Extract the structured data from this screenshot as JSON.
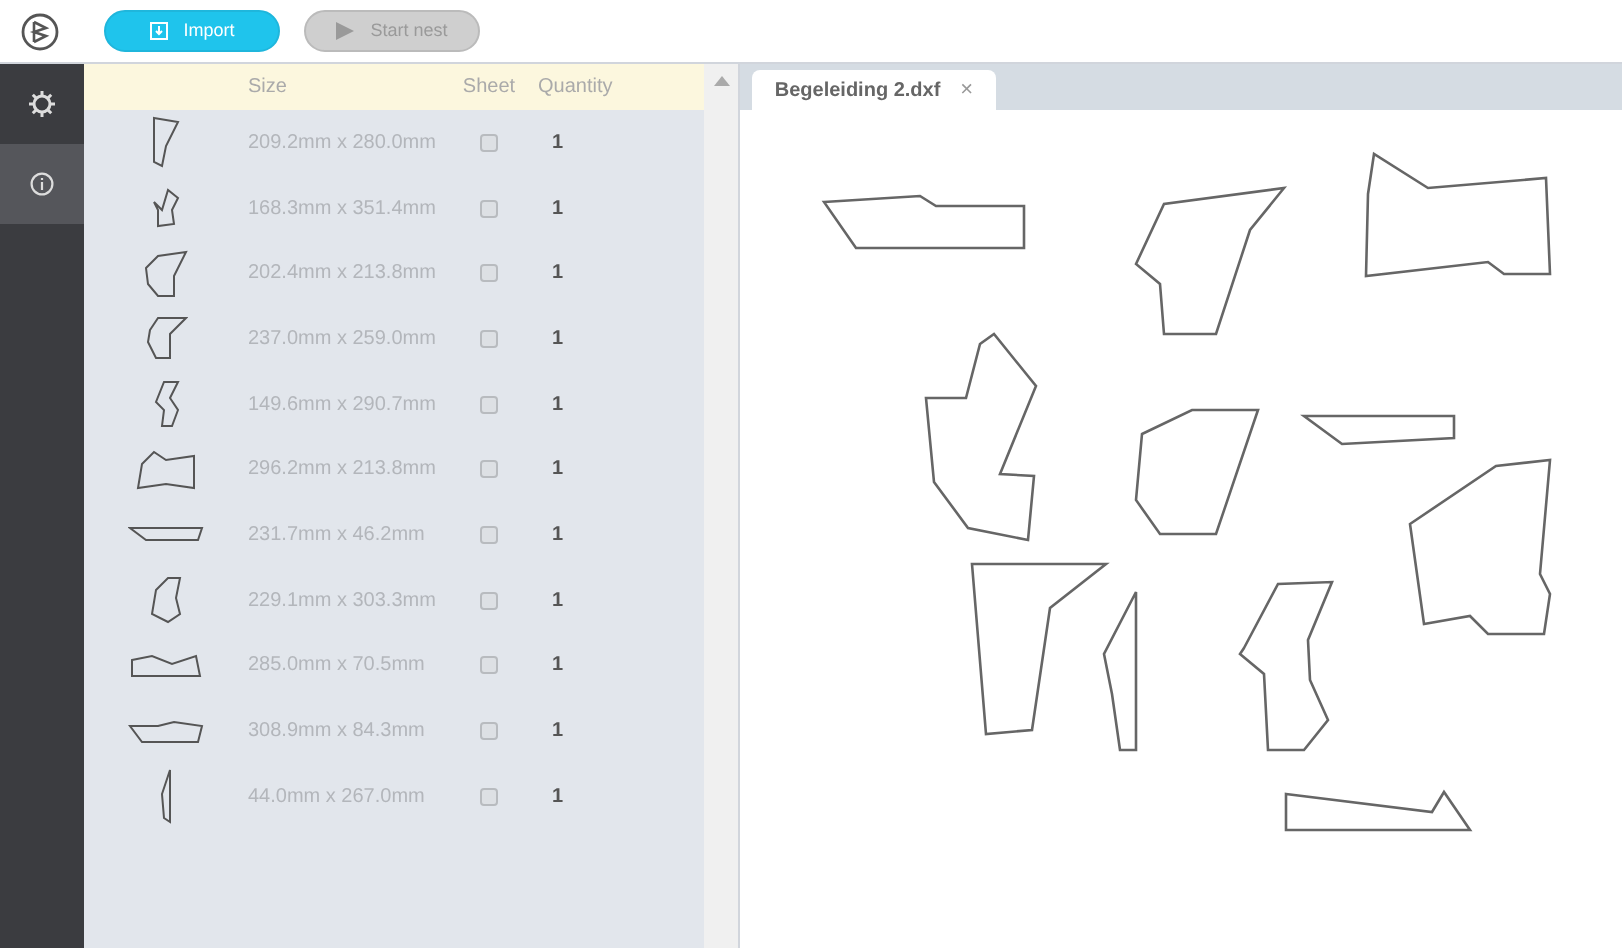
{
  "toolbar": {
    "buttons": [
      {
        "label": "Import",
        "kind": "primary",
        "disabled": false
      },
      {
        "label": "Start nest",
        "kind": "play",
        "disabled": true
      }
    ]
  },
  "sidebar": {
    "items": [
      {
        "kind": "settings",
        "selected": false
      },
      {
        "kind": "info",
        "selected": true
      }
    ]
  },
  "parts_table": {
    "columns": [
      "Size",
      "Sheet",
      "Quantity"
    ],
    "rows": [
      {
        "size": "209.2mm x 280.0mm",
        "sheet": false,
        "quantity": "1"
      },
      {
        "size": "168.3mm x 351.4mm",
        "sheet": false,
        "quantity": "1"
      },
      {
        "size": "202.4mm x 213.8mm",
        "sheet": false,
        "quantity": "1"
      },
      {
        "size": "237.0mm x 259.0mm",
        "sheet": false,
        "quantity": "1"
      },
      {
        "size": "149.6mm x 290.7mm",
        "sheet": false,
        "quantity": "1"
      },
      {
        "size": "296.2mm x 213.8mm",
        "sheet": false,
        "quantity": "1"
      },
      {
        "size": "231.7mm x 46.2mm",
        "sheet": false,
        "quantity": "1"
      },
      {
        "size": "229.1mm x 303.3mm",
        "sheet": false,
        "quantity": "1"
      },
      {
        "size": "285.0mm x 70.5mm",
        "sheet": false,
        "quantity": "1"
      },
      {
        "size": "308.9mm x 84.3mm",
        "sheet": false,
        "quantity": "1"
      },
      {
        "size": "44.0mm x 267.0mm",
        "sheet": false,
        "quantity": "1"
      }
    ]
  },
  "tabs": [
    {
      "label": "Begeleiding 2.dxf",
      "selected": true,
      "close": "×"
    }
  ]
}
